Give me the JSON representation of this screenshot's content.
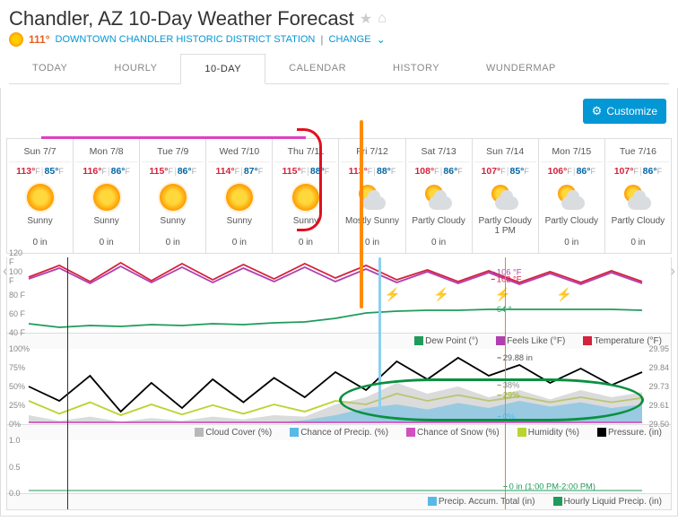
{
  "header": {
    "title": "Chandler, AZ 10-Day Weather Forecast",
    "current_temp": "111°",
    "station": "DOWNTOWN CHANDLER HISTORIC DISTRICT STATION",
    "change_label": "CHANGE"
  },
  "tabs": [
    "TODAY",
    "HOURLY",
    "10-DAY",
    "CALENDAR",
    "HISTORY",
    "WUNDERMAP"
  ],
  "active_tab": "10-DAY",
  "customize_label": "Customize",
  "days": [
    {
      "label": "Sun 7/7",
      "hi": "113",
      "lo": "85",
      "cond": "Sunny",
      "cond2": "",
      "precip": "0 in",
      "icon": "sun"
    },
    {
      "label": "Mon 7/8",
      "hi": "116",
      "lo": "86",
      "cond": "Sunny",
      "cond2": "",
      "precip": "0 in",
      "icon": "sun"
    },
    {
      "label": "Tue 7/9",
      "hi": "115",
      "lo": "86",
      "cond": "Sunny",
      "cond2": "",
      "precip": "0 in",
      "icon": "sun"
    },
    {
      "label": "Wed 7/10",
      "hi": "114",
      "lo": "87",
      "cond": "Sunny",
      "cond2": "",
      "precip": "0 in",
      "icon": "sun"
    },
    {
      "label": "Thu 7/11",
      "hi": "115",
      "lo": "88",
      "cond": "Sunny",
      "cond2": "",
      "precip": "0 in",
      "icon": "sun"
    },
    {
      "label": "Fri 7/12",
      "hi": "113",
      "lo": "88",
      "cond": "Mostly Sunny",
      "cond2": "",
      "precip": "0 in",
      "icon": "cloud"
    },
    {
      "label": "Sat 7/13",
      "hi": "108",
      "lo": "86",
      "cond": "Partly Cloudy",
      "cond2": "",
      "precip": "0 in",
      "icon": "cloud"
    },
    {
      "label": "Sun 7/14",
      "hi": "107",
      "lo": "85",
      "cond": "Partly Cloudy",
      "cond2": "1 PM",
      "precip": "",
      "icon": "cloud"
    },
    {
      "label": "Mon 7/15",
      "hi": "106",
      "lo": "86",
      "cond": "Partly Cloudy",
      "cond2": "",
      "precip": "0 in",
      "icon": "cloud"
    },
    {
      "label": "Tue 7/16",
      "hi": "107",
      "lo": "86",
      "cond": "Partly Cloudy",
      "cond2": "",
      "precip": "0 in",
      "icon": "cloud"
    }
  ],
  "chart_data": {
    "type": "line",
    "panels": [
      {
        "name": "temp",
        "y_left": [
          "120 F",
          "100 F",
          "80 F",
          "60 F",
          "40 F"
        ],
        "series": [
          {
            "name": "Temperature",
            "color": "#d6223c",
            "values": [
              100,
              113,
              95,
              116,
              96,
              115,
              97,
              114,
              98,
              115,
              99,
              113,
              97,
              108,
              95,
              107,
              94,
              106,
              94,
              107,
              95
            ]
          },
          {
            "name": "Feels Like",
            "color": "#b040b0",
            "values": [
              98,
              110,
              93,
              112,
              94,
              111,
              94,
              110,
              95,
              111,
              95,
              109,
              94,
              106,
              93,
              105,
              92,
              104,
              92,
              105,
              93
            ]
          },
          {
            "name": "Dew Point",
            "color": "#1f9b5b",
            "values": [
              48,
              44,
              46,
              45,
              47,
              46,
              48,
              47,
              49,
              50,
              54,
              60,
              62,
              63,
              63,
              64,
              64,
              64,
              64,
              64,
              63
            ]
          }
        ],
        "callouts": [
          {
            "text": "106 °F",
            "color": "#b040b0",
            "x": 0.76,
            "y": 0.18
          },
          {
            "text": "102 °F",
            "color": "#d6223c",
            "x": 0.76,
            "y": 0.28
          },
          {
            "text": "64 °",
            "color": "#1f9b5b",
            "x": 0.76,
            "y": 0.7
          }
        ],
        "lightning_x": [
          0.58,
          0.66,
          0.76,
          0.86
        ],
        "legend": [
          {
            "c": "#1f9b5b",
            "t": "Dew Point (°)"
          },
          {
            "c": "#b040b0",
            "t": "Feels Like (°F)"
          },
          {
            "c": "#d6223c",
            "t": "Temperature (°F)"
          }
        ]
      },
      {
        "name": "humidity",
        "y_left": [
          "100%",
          "75%",
          "50%",
          "25%",
          "0%"
        ],
        "y_right": [
          "29.95",
          "29.84",
          "29.73",
          "29.61",
          "29.50"
        ],
        "series": [
          {
            "name": "Pressure",
            "color": "#000000",
            "values": [
              50,
              30,
              65,
              15,
              55,
              20,
              60,
              28,
              62,
              35,
              70,
              45,
              85,
              60,
              90,
              65,
              80,
              55,
              75,
              52,
              70
            ]
          },
          {
            "name": "Humidity",
            "color": "#b8d430",
            "values": [
              30,
              12,
              28,
              10,
              25,
              11,
              24,
              12,
              25,
              15,
              30,
              25,
              40,
              30,
              38,
              30,
              36,
              28,
              35,
              28,
              34
            ]
          },
          {
            "name": "Cloud Cover",
            "color": "#b8b8b8",
            "fill": true,
            "values": [
              10,
              2,
              8,
              1,
              6,
              2,
              8,
              4,
              10,
              8,
              25,
              35,
              55,
              40,
              50,
              35,
              45,
              32,
              45,
              35,
              42
            ]
          },
          {
            "name": "Chance of Precip.",
            "color": "#58b9e8",
            "fill": true,
            "values": [
              0,
              0,
              0,
              0,
              0,
              0,
              0,
              0,
              0,
              3,
              10,
              20,
              25,
              18,
              27,
              20,
              30,
              22,
              28,
              20,
              25
            ]
          },
          {
            "name": "Chance of Snow",
            "color": "#d050c0",
            "values": [
              0,
              0,
              0,
              0,
              0,
              0,
              0,
              0,
              0,
              0,
              0,
              0,
              0,
              0,
              0,
              0,
              0,
              0,
              0,
              0,
              0
            ]
          }
        ],
        "callouts": [
          {
            "text": "29.88 in",
            "color": "#555",
            "x": 0.77,
            "y": 0.1
          },
          {
            "text": "38%",
            "color": "#888",
            "x": 0.77,
            "y": 0.48
          },
          {
            "text": "29%",
            "color": "#9cb020",
            "x": 0.77,
            "y": 0.62
          },
          {
            "text": "0%",
            "color": "#58b9e8",
            "x": 0.77,
            "y": 0.92
          }
        ],
        "legend": [
          {
            "c": "#b8b8b8",
            "t": "Cloud Cover (%)"
          },
          {
            "c": "#58b9e8",
            "t": "Chance of Precip. (%)"
          },
          {
            "c": "#d050c0",
            "t": "Chance of Snow (%)"
          },
          {
            "c": "#b8d430",
            "t": "Humidity (%)"
          },
          {
            "c": "#000000",
            "t": "Pressure. (in)"
          }
        ]
      },
      {
        "name": "precip",
        "y_left": [
          "1.0",
          "0.5",
          "0.0"
        ],
        "callouts": [
          {
            "text": "0 in (1:00 PM-2:00 PM)",
            "color": "#1f9b5b",
            "x": 0.78,
            "y": 0.9
          }
        ],
        "legend": [
          {
            "c": "#58b9e8",
            "t": "Precip. Accum. Total (in)"
          },
          {
            "c": "#1f9b5b",
            "t": "Hourly Liquid Precip. (in)"
          }
        ]
      }
    ],
    "now_line_x": 0.09,
    "selected_line_x": 0.75
  }
}
